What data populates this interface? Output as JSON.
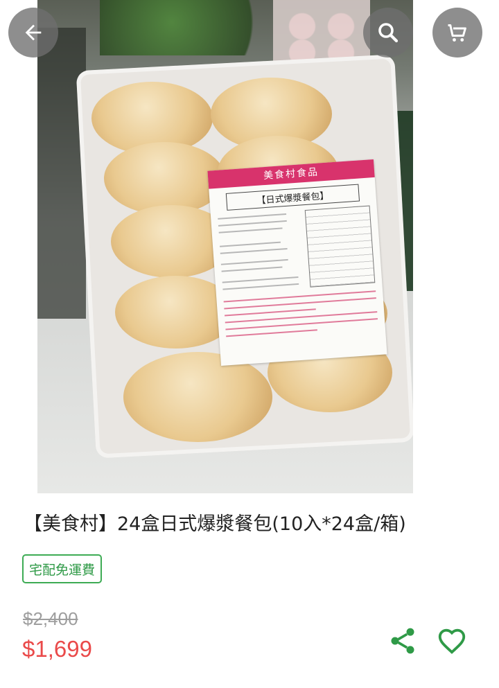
{
  "product": {
    "title": "【美食村】24盒日式爆漿餐包(10入*24盒/箱)",
    "badge": "宅配免運費",
    "original_price": "$2,400",
    "sale_price": "$1,699"
  },
  "photo_label": {
    "brand": "美食村食品",
    "product_name": "【日式爆漿餐包】"
  },
  "icons": {
    "back": "arrow-left-icon",
    "search": "search-icon",
    "cart": "cart-icon",
    "share": "share-icon",
    "favorite": "heart-icon"
  },
  "colors": {
    "accent_green": "#3dab54",
    "price_red": "#ea4a4a",
    "overlay_button": "#6e6e6e"
  }
}
